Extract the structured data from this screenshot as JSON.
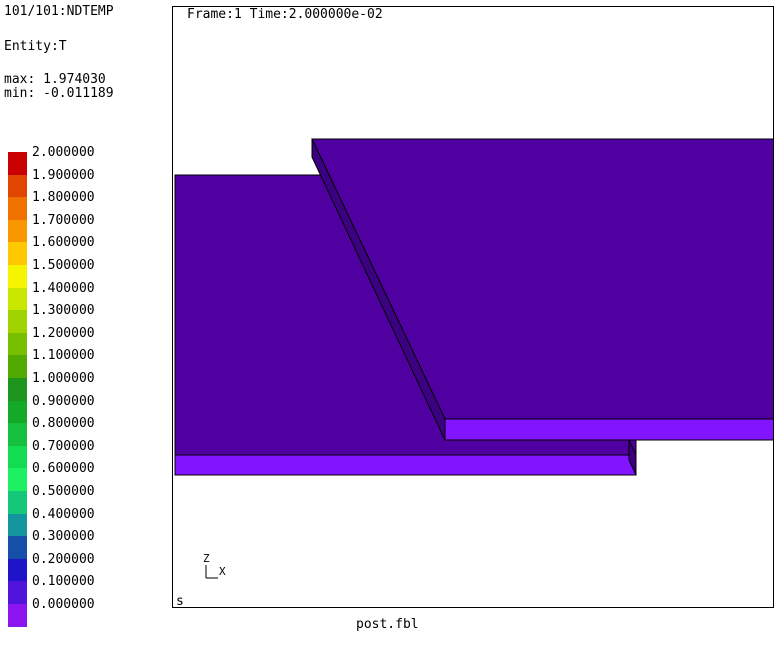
{
  "info": {
    "result": "101/101:NDTEMP",
    "entity": "Entity:T",
    "max": "max: 1.974030",
    "min": "min: -0.011189"
  },
  "legend": [
    {
      "label": "2.000000",
      "color": "#c80000"
    },
    {
      "label": "1.900000",
      "color": "#e04600"
    },
    {
      "label": "1.800000",
      "color": "#f07000"
    },
    {
      "label": "1.700000",
      "color": "#fa9600"
    },
    {
      "label": "1.600000",
      "color": "#ffc800"
    },
    {
      "label": "1.500000",
      "color": "#f5f500"
    },
    {
      "label": "1.400000",
      "color": "#c8e600"
    },
    {
      "label": "1.300000",
      "color": "#a0d200"
    },
    {
      "label": "1.200000",
      "color": "#78be00"
    },
    {
      "label": "1.100000",
      "color": "#50aa00"
    },
    {
      "label": "1.000000",
      "color": "#1e961e"
    },
    {
      "label": "0.900000",
      "color": "#14aa28"
    },
    {
      "label": "0.800000",
      "color": "#14c03c"
    },
    {
      "label": "0.700000",
      "color": "#14dc50"
    },
    {
      "label": "0.600000",
      "color": "#1ef064"
    },
    {
      "label": "0.500000",
      "color": "#14c87a"
    },
    {
      "label": "0.400000",
      "color": "#14969e"
    },
    {
      "label": "0.300000",
      "color": "#1450aa"
    },
    {
      "label": "0.200000",
      "color": "#1e14c8"
    },
    {
      "label": "0.100000",
      "color": "#5014dc"
    },
    {
      "label": "0.000000",
      "color": "#8c14f0"
    }
  ],
  "viewport": {
    "frame_text": "Frame:1 Time:2.000000e-02",
    "status_char": "s",
    "triad": {
      "z_label": "Z",
      "x_label": "X"
    }
  },
  "colors": {
    "plate_top": "#5000a0",
    "plate_front": "#8214ff",
    "plate_side": "#3c0082"
  },
  "footer": {
    "filename": "post.fbl"
  }
}
